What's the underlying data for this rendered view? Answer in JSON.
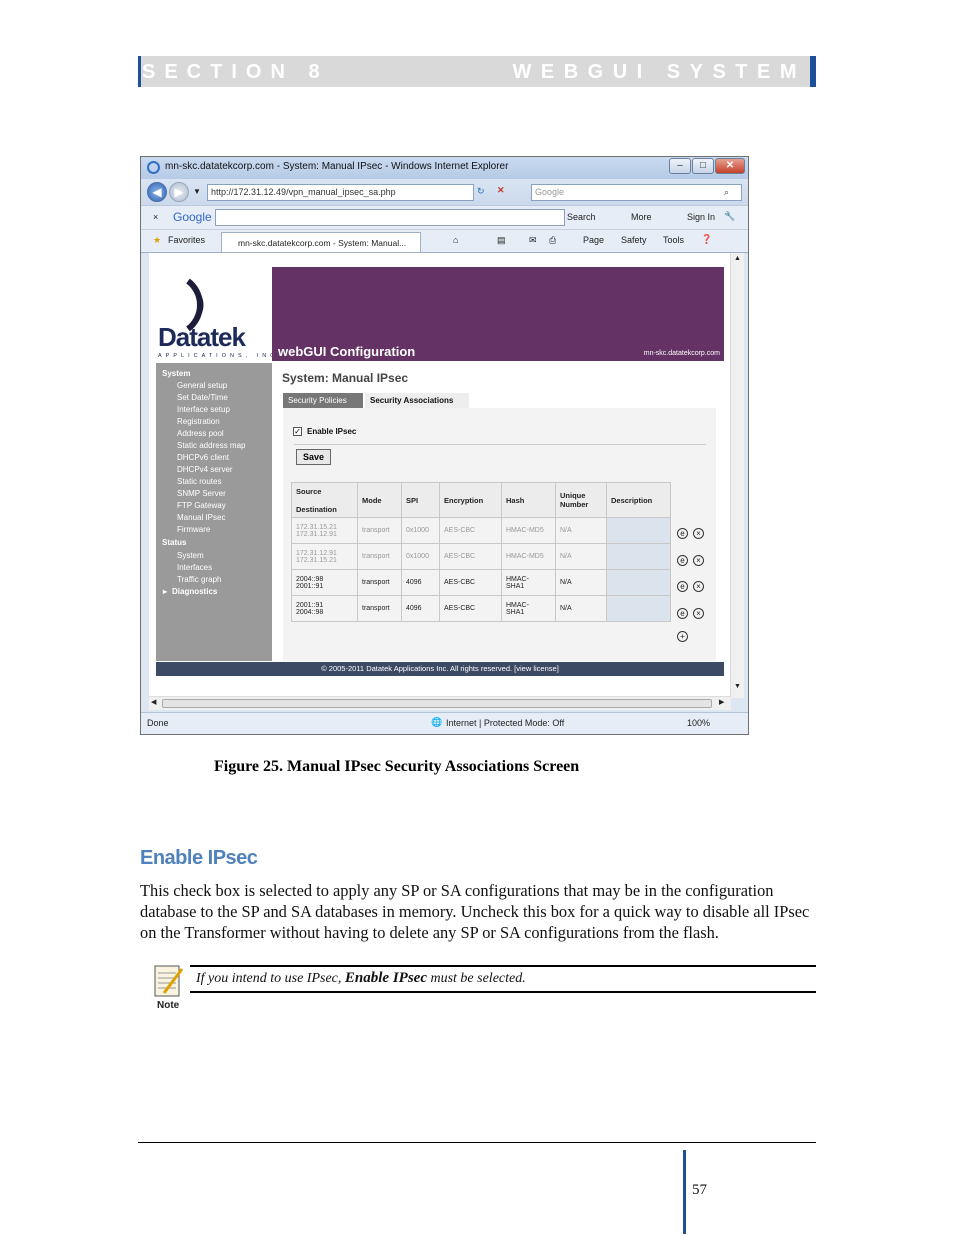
{
  "header": {
    "section": "SECTION 8",
    "title": "WEBGUI SYSTEM"
  },
  "browser": {
    "window_title": "mn-skc.datatekcorp.com - System: Manual IPsec - Windows Internet Explorer",
    "url": "http://172.31.12.49/vpn_manual_ipsec_sa.php",
    "search_placeholder": "Google",
    "google_logo": "Google",
    "toolbar_search": "Search",
    "toolbar_more": "More",
    "toolbar_signin": "Sign In",
    "favorites": "Favorites",
    "tab_title": "mn-skc.datatekcorp.com - System: Manual...",
    "cmd_page": "Page",
    "cmd_safety": "Safety",
    "cmd_tools": "Tools",
    "status_done": "Done",
    "status_zone": "Internet | Protected Mode: Off",
    "zoom": "100%"
  },
  "webgui": {
    "logo_text": "Datatek",
    "logo_sub": "APPLICATIONS, INC",
    "banner_title": "webGUI Configuration",
    "hostname": "mn-skc.datatekcorp.com",
    "page_title": "System: Manual IPsec",
    "tabs": [
      "Security Policies",
      "Security Associations"
    ],
    "enable_label": "Enable IPsec",
    "save_label": "Save",
    "nav": {
      "system": "System",
      "system_items": [
        "General setup",
        "Set Date/Time",
        "Interface setup",
        "Registration",
        "Address pool",
        "Static address map",
        "DHCPv6 client",
        "DHCPv4 server",
        "Static routes",
        "SNMP Server",
        "FTP Gateway",
        "Manual IPsec",
        "Firmware"
      ],
      "status": "Status",
      "status_items": [
        "System",
        "Interfaces",
        "Traffic graph"
      ],
      "diagnostics": "Diagnostics"
    },
    "columns": {
      "source": "Source",
      "destination": "Destination",
      "mode": "Mode",
      "spi": "SPI",
      "encryption": "Encryption",
      "hash": "Hash",
      "unique_1": "Unique",
      "unique_2": "Number",
      "description": "Description"
    },
    "rows": [
      {
        "src": "172.31.15.21",
        "dst": "172.31.12.91",
        "mode": "transport",
        "spi": "0x1000",
        "enc": "AES-CBC",
        "hash1": "HMAC-MD5",
        "hash2": "",
        "uniq": "N/A"
      },
      {
        "src": "172.31.12.91",
        "dst": "172.31.15.21",
        "mode": "transport",
        "spi": "0x1000",
        "enc": "AES-CBC",
        "hash1": "HMAC-MD5",
        "hash2": "",
        "uniq": "N/A"
      },
      {
        "src": "2004::98",
        "dst": "2001::91",
        "mode": "transport",
        "spi": "4096",
        "enc": "AES-CBC",
        "hash1": "HMAC-",
        "hash2": "SHA1",
        "uniq": "N/A"
      },
      {
        "src": "2001::91",
        "dst": "2004::98",
        "mode": "transport",
        "spi": "4096",
        "enc": "AES-CBC",
        "hash1": "HMAC-",
        "hash2": "SHA1",
        "uniq": "N/A"
      }
    ],
    "footer": "© 2005-2011 Datatek Applications Inc. All rights reserved.  [view license]"
  },
  "doc": {
    "caption": "Figure 25. Manual IPsec Security Associations Screen",
    "heading": "Enable IPsec",
    "paragraph": "This check box is selected to apply any SP or SA configurations that may be in the configuration database to the SP and SA databases in memory.  Uncheck this box for a quick way to disable all IPsec on the Transformer without having to delete any SP or SA configurations from the flash.",
    "note_pre": "If you intend to use IPsec, ",
    "note_bold": "Enable IPsec",
    "note_post": " must be selected.",
    "note_label": "Note",
    "page_number": "57"
  }
}
